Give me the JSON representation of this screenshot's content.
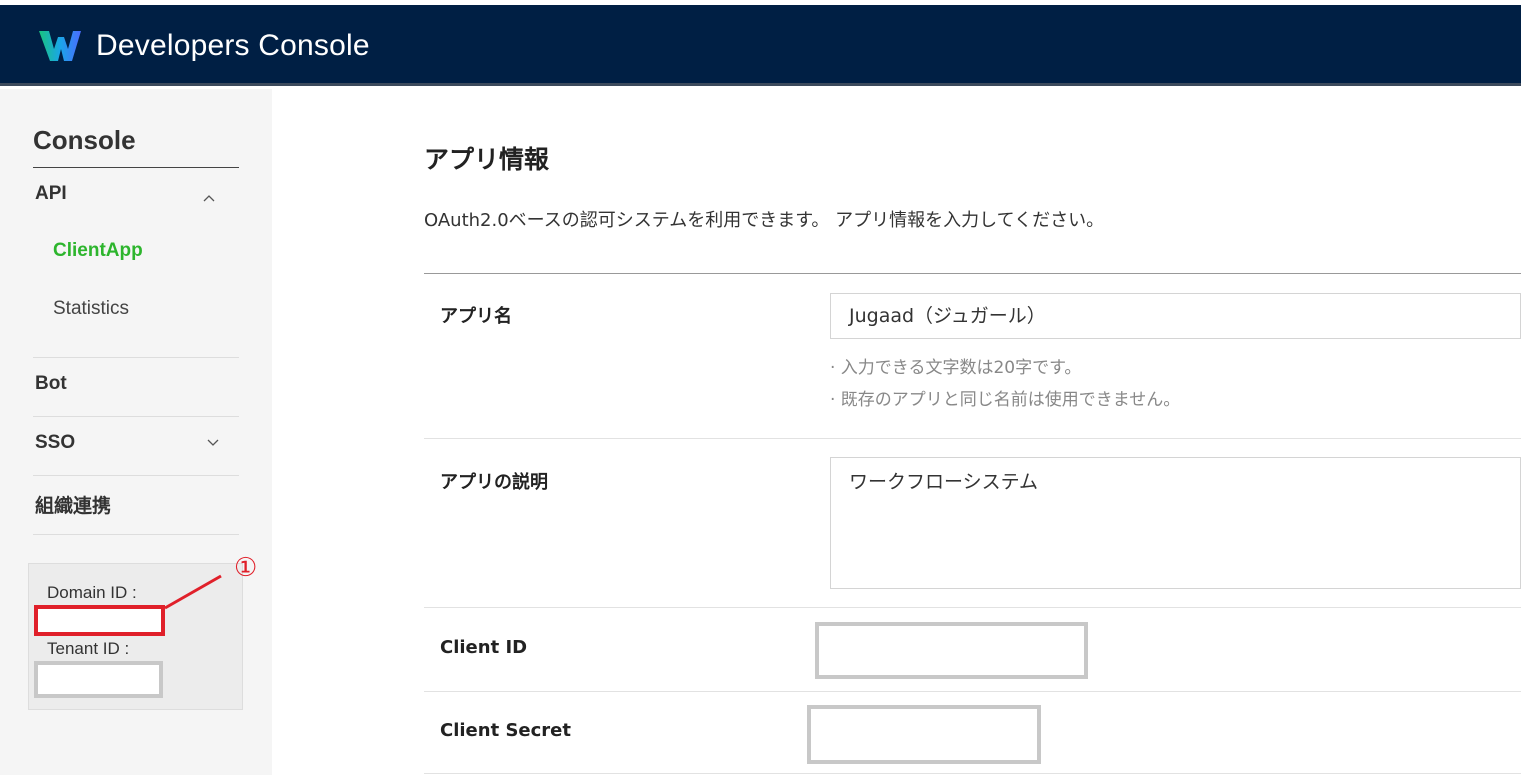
{
  "header": {
    "title": "Developers Console",
    "logo_icon": "w-logo-icon",
    "background": "#001f44"
  },
  "sidebar": {
    "title": "Console",
    "api_label": "API",
    "client_app_label": "ClientApp",
    "statistics_label": "Statistics",
    "bot_label": "Bot",
    "sso_label": "SSO",
    "org_label": "組織連携",
    "domain_id_label": "Domain ID :",
    "tenant_id_label": "Tenant ID :",
    "active_color": "#2db52d"
  },
  "annotation": {
    "marker": "①",
    "color": "#e0202a"
  },
  "main": {
    "title": "アプリ情報",
    "description": "OAuth2.0ベースの認可システムを利用できます。 アプリ情報を入力してください。",
    "app_name_label": "アプリ名",
    "app_name_value": "Jugaad（ジュガール）",
    "hint_1": "· 入力できる文字数は20字です。",
    "hint_2": "· 既存のアプリと同じ名前は使用できません。",
    "app_desc_label": "アプリの説明",
    "app_desc_value": "ワークフローシステム",
    "client_id_label": "Client ID",
    "client_secret_label": "Client Secret"
  }
}
